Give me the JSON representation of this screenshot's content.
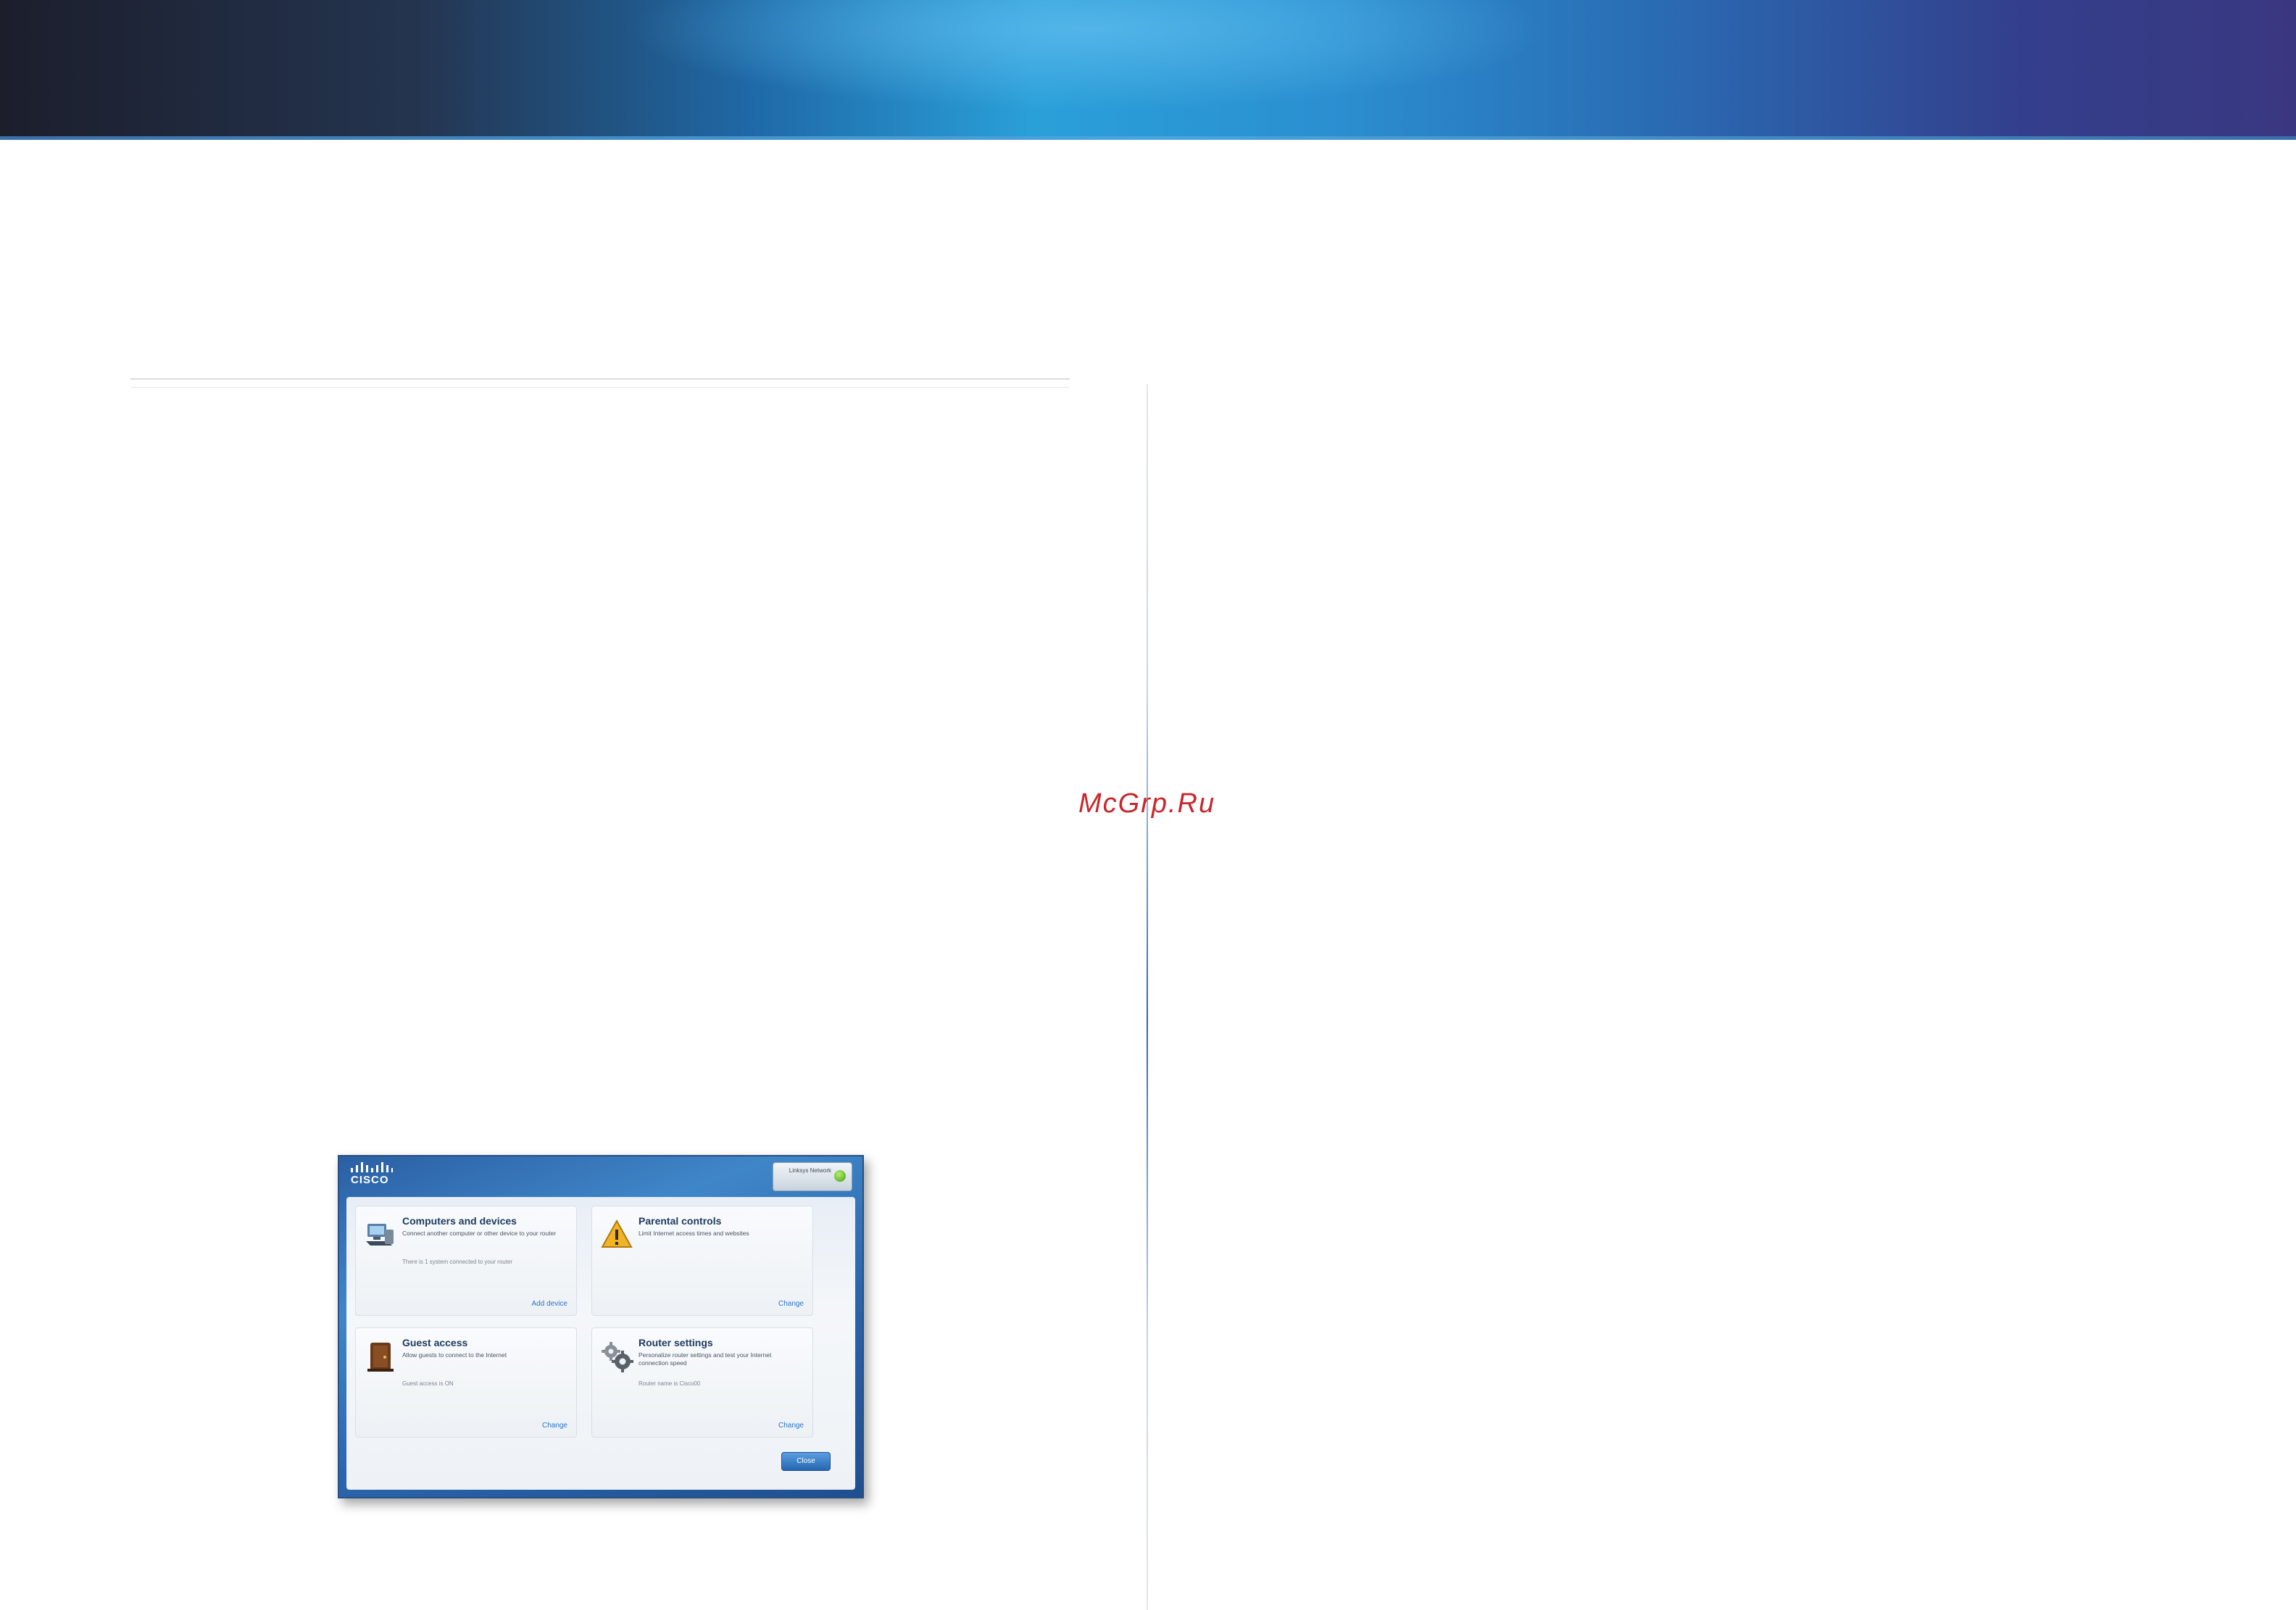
{
  "watermark": "McGrp.Ru",
  "router_ui": {
    "brand": "CISCO",
    "status_text": "Linksys Network",
    "cards": [
      {
        "title": "Computers and devices",
        "description": "Connect another computer or other device to your router",
        "status": "There is 1 system connected to your router",
        "link": "Add device",
        "icon": "computer-icon"
      },
      {
        "title": "Parental controls",
        "description": "Limit Internet access times and websites",
        "status": "",
        "link": "Change",
        "icon": "warning-sign-icon"
      },
      {
        "title": "Guest access",
        "description": "Allow guests to connect to the Internet",
        "status": "Guest access is ON",
        "link": "Change",
        "icon": "guest-door-icon"
      },
      {
        "title": "Router settings",
        "description": "Personalize router settings and test your Internet connection speed",
        "status": "Router name is Cisco00",
        "link": "Change",
        "icon": "gears-icon"
      }
    ],
    "close_label": "Close"
  }
}
